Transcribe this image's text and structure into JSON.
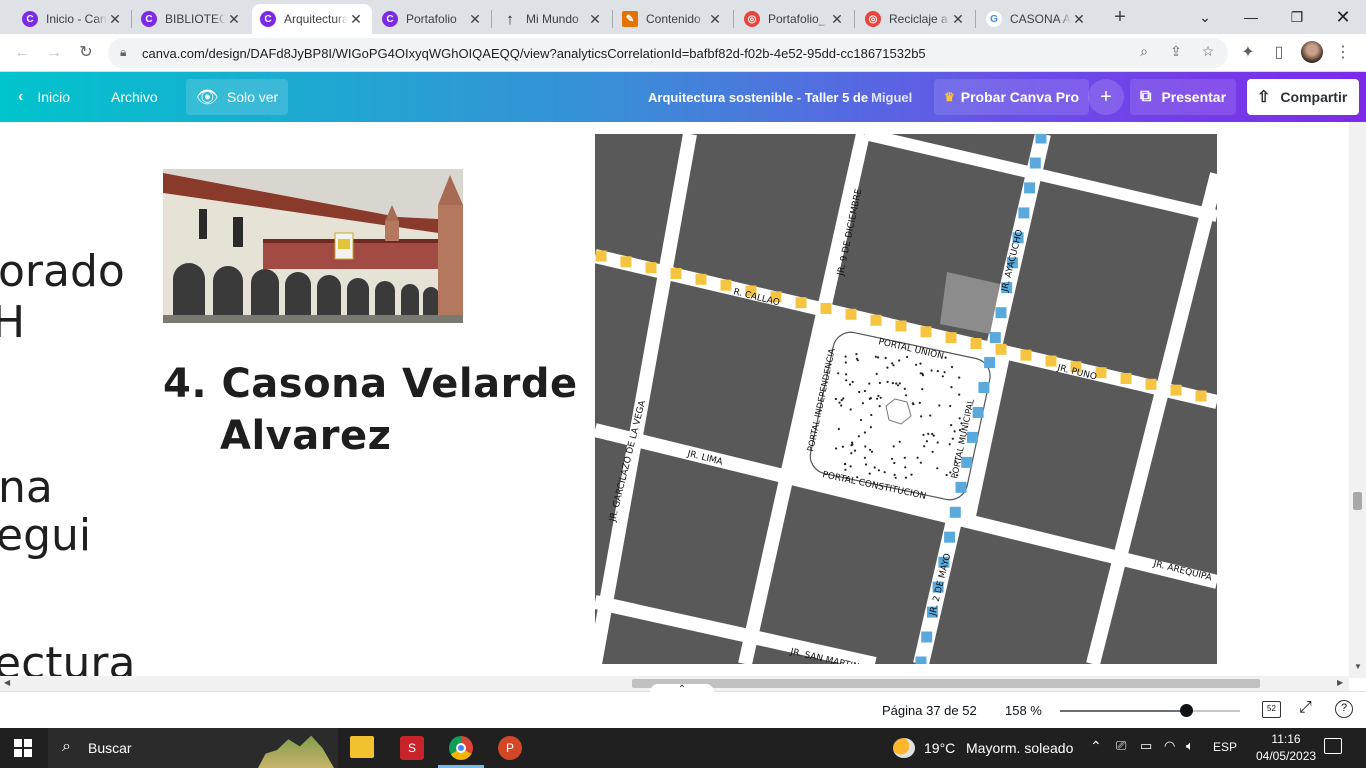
{
  "browser": {
    "tabs": [
      {
        "title": "Inicio - Canva",
        "favicon_color": "#7d2ae8",
        "favicon_glyph": "C"
      },
      {
        "title": "BIBLIOTECA",
        "favicon_color": "#7d2ae8",
        "favicon_glyph": "C"
      },
      {
        "title": "Arquitectura",
        "favicon_color": "#7d2ae8",
        "favicon_glyph": "C",
        "active": true
      },
      {
        "title": "Portafolio",
        "favicon_color": "#7d2ae8",
        "favicon_glyph": "C"
      },
      {
        "title": "Mi Mundo",
        "favicon_color": "#202124",
        "favicon_glyph": "↑"
      },
      {
        "title": "Contenido",
        "favicon_color": "#e37400",
        "favicon_glyph": "✎"
      },
      {
        "title": "Portafolio_",
        "favicon_color": "#e8453c",
        "favicon_glyph": "◎"
      },
      {
        "title": "Reciclaje a",
        "favicon_color": "#e8453c",
        "favicon_glyph": "◎"
      },
      {
        "title": "CASONA A",
        "favicon_color": "#4285f4",
        "favicon_glyph": "G"
      }
    ],
    "new_tab": "+",
    "url": "canva.com/design/DAFd8JyBP8I/WIGoPG4OIxyqWGhOIQAEQQ/view?analyticsCorrelationId=bafbf82d-f02b-4e52-95dd-cc18671532b5"
  },
  "canva_header": {
    "back_label": "Inicio",
    "file_label": "Archivo",
    "view_mode_label": "Solo ver",
    "doc_title": "Arquitectura sostenible - Taller 5 de ",
    "doc_author": "Miguel",
    "pro_label": "Probar Canva Pro",
    "plus_label": "+",
    "present_label": "Presentar",
    "share_label": "Compartir"
  },
  "slide": {
    "left_fragments": [
      "orado",
      "H",
      "na",
      "egui",
      "ectura"
    ],
    "heading_line1": "4. Casona Velarde",
    "heading_line2": "Alvarez",
    "map_labels": {
      "jr_9_diciembre": "JR. 9 DE DICIEMBRE",
      "jr_callao": "R. CALLAO",
      "portal_union": "PORTAL UNION",
      "jr_ayacucho": "JR. AYACUCHO",
      "jr_lima": "JR. LIMA",
      "portal_independencia": "PORTAL INDEPENDENCIA",
      "portal_municipal": "PORTAL MUNICIPAL",
      "portal_constitucion": "PORTAL CONSTITUCION",
      "jr_garcilazo": "JR. GARCILAZO DE LA VEGA",
      "jr_2_mayo": "JR. 2 DE MAYO",
      "jr_arequipa": "JR. AREQUIPA",
      "jr_san_martin": "JR. SAN MARTIN",
      "jr_puno": "JR. PUNO"
    }
  },
  "footer": {
    "page_label": "Página 37 de 52",
    "zoom_label": "158 %",
    "zoom_level": 0.7,
    "page_count_badge": "52"
  },
  "taskbar": {
    "search_placeholder": "Buscar",
    "weather_temp": "19°C",
    "weather_desc": "Mayorm. soleado",
    "language": "ESP",
    "time": "11:16",
    "date": "04/05/2023"
  },
  "colors": {
    "yellow_route": "#f5c542",
    "blue_route": "#5aa9dd",
    "map_block": "#595959",
    "street": "#ffffff"
  }
}
